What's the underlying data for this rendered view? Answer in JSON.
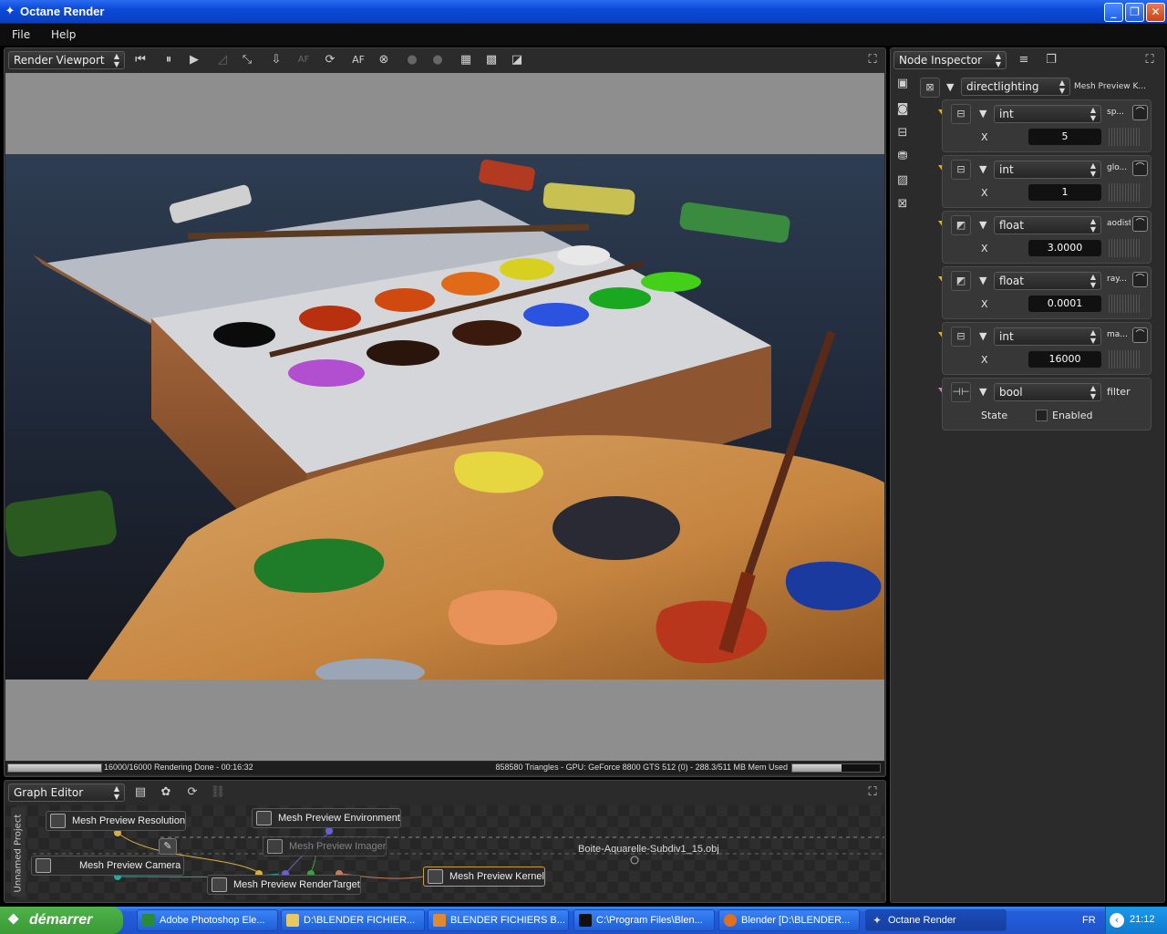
{
  "window": {
    "title": "Octane Render"
  },
  "menu": [
    "File",
    "Help"
  ],
  "viewport": {
    "dropdown": "Render Viewport",
    "toolbar_af": "AF",
    "status_left": "16000/16000 Rendering Done - 00:16:32",
    "status_right": "858580 Triangles - GPU: GeForce 8800 GTS 512 (0) - 288.3/511 MB Mem Used",
    "progress": 1.0
  },
  "inspector": {
    "dropdown": "Node Inspector",
    "root_type": "directlighting",
    "root_name": "Mesh Preview K...",
    "pins": [
      {
        "type": "int",
        "short": "sp...",
        "label": "X",
        "value": "5",
        "color": "#d8b040"
      },
      {
        "type": "int",
        "short": "glo...",
        "label": "X",
        "value": "1",
        "color": "#d8b040"
      },
      {
        "type": "float",
        "short": "aodist",
        "label": "X",
        "value": "3.0000",
        "color": "#7aa0d0"
      },
      {
        "type": "float",
        "short": "ray...",
        "label": "X",
        "value": "0.0001",
        "color": "#7aa0d0"
      },
      {
        "type": "int",
        "short": "ma...",
        "label": "X",
        "value": "16000",
        "color": "#d8b040"
      }
    ],
    "bool_pin": {
      "type": "bool",
      "short": "filter",
      "label": "State",
      "check_label": "Enabled",
      "color": "#c080c0"
    }
  },
  "graph": {
    "dropdown": "Graph Editor",
    "project_label": "Unnamed Project",
    "nodes": {
      "resolution": "Mesh Preview Resolution",
      "environment": "Mesh Preview Environment",
      "imager": "Mesh Preview Imager",
      "camera": "Mesh Preview Camera",
      "rendertarget": "Mesh Preview RenderTarget",
      "kernel": "Mesh Preview Kernel",
      "mesh": "Boite-Aquarelle-Subdiv1_15.obj"
    }
  },
  "taskbar": {
    "start": "démarrer",
    "items": [
      "Adobe Photoshop Ele...",
      "D:\\BLENDER FICHIER...",
      "BLENDER FICHIERS B...",
      "C:\\Program Files\\Blen...",
      "Blender [D:\\BLENDER...",
      "Octane Render"
    ],
    "lang": "FR",
    "clock": "21:12"
  }
}
